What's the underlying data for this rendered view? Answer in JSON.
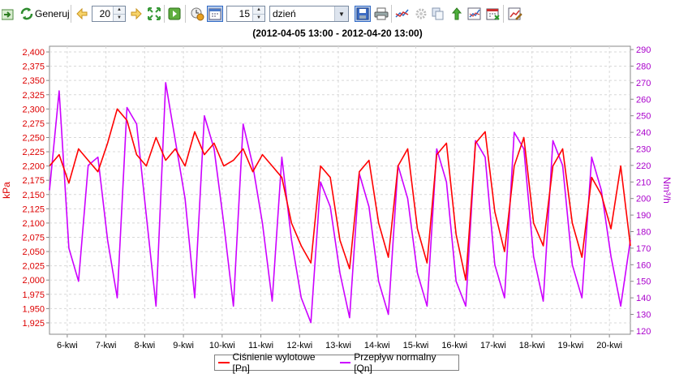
{
  "toolbar": {
    "generate_label": "Generuj",
    "count_value": "20",
    "interval_value": "15",
    "period_value": "dzień",
    "colors": {
      "accent": "#316ac5"
    }
  },
  "chart_data": {
    "type": "line",
    "title": "(2012-04-05 13:00 - 2012-04-20 13:00)",
    "xlabel": "",
    "ylabel": "kPa",
    "ylabel_right": "Nm³/h",
    "x_tick_labels": [
      "6-kwi",
      "7-kwi",
      "8-kwi",
      "9-kwi",
      "10-kwi",
      "11-kwi",
      "12-kwi",
      "13-kwi",
      "14-kwi",
      "15-kwi",
      "16-kwi",
      "17-kwi",
      "18-kwi",
      "19-kwi",
      "20-kwi"
    ],
    "x_range": [
      "2012-04-05 13:00",
      "2012-04-20 13:00"
    ],
    "y_left_ticks": [
      "1,925",
      "1,950",
      "1,975",
      "2,000",
      "2,025",
      "2,050",
      "2,075",
      "2,100",
      "2,125",
      "2,150",
      "2,175",
      "2,200",
      "2,225",
      "2,250",
      "2,275",
      "2,300",
      "2,325",
      "2,350",
      "2,375",
      "2,400"
    ],
    "y_right_ticks": [
      "120",
      "130",
      "140",
      "150",
      "160",
      "170",
      "180",
      "190",
      "200",
      "210",
      "220",
      "230",
      "240",
      "250",
      "260",
      "270",
      "280",
      "290"
    ],
    "ylim_left": [
      1.905,
      2.41
    ],
    "ylim_right": [
      118,
      292
    ],
    "grid": true,
    "legend_position": "bottom-center",
    "series": [
      {
        "name": "Ciśnienie wylotowe [Pn]",
        "axis": "left",
        "color": "#ff0000",
        "x": [
          "2012-04-05 13:00",
          "2012-04-05 19:00",
          "2012-04-06 01:00",
          "2012-04-06 07:00",
          "2012-04-06 13:00",
          "2012-04-06 19:00",
          "2012-04-07 01:00",
          "2012-04-07 07:00",
          "2012-04-07 13:00",
          "2012-04-07 19:00",
          "2012-04-08 01:00",
          "2012-04-08 07:00",
          "2012-04-08 13:00",
          "2012-04-08 19:00",
          "2012-04-09 01:00",
          "2012-04-09 07:00",
          "2012-04-09 13:00",
          "2012-04-09 19:00",
          "2012-04-10 01:00",
          "2012-04-10 07:00",
          "2012-04-10 13:00",
          "2012-04-10 19:00",
          "2012-04-11 01:00",
          "2012-04-11 07:00",
          "2012-04-11 13:00",
          "2012-04-11 19:00",
          "2012-04-12 01:00",
          "2012-04-12 07:00",
          "2012-04-12 13:00",
          "2012-04-12 19:00",
          "2012-04-13 01:00",
          "2012-04-13 07:00",
          "2012-04-13 13:00",
          "2012-04-13 19:00",
          "2012-04-14 01:00",
          "2012-04-14 07:00",
          "2012-04-14 13:00",
          "2012-04-14 19:00",
          "2012-04-15 01:00",
          "2012-04-15 07:00",
          "2012-04-15 13:00",
          "2012-04-15 19:00",
          "2012-04-16 01:00",
          "2012-04-16 07:00",
          "2012-04-16 13:00",
          "2012-04-16 19:00",
          "2012-04-17 01:00",
          "2012-04-17 07:00",
          "2012-04-17 13:00",
          "2012-04-17 19:00",
          "2012-04-18 01:00",
          "2012-04-18 07:00",
          "2012-04-18 13:00",
          "2012-04-18 19:00",
          "2012-04-19 01:00",
          "2012-04-19 07:00",
          "2012-04-19 13:00",
          "2012-04-19 19:00",
          "2012-04-20 01:00",
          "2012-04-20 07:00",
          "2012-04-20 13:00"
        ],
        "values": [
          2.2,
          2.22,
          2.17,
          2.23,
          2.21,
          2.19,
          2.24,
          2.3,
          2.28,
          2.22,
          2.2,
          2.25,
          2.21,
          2.23,
          2.2,
          2.26,
          2.22,
          2.24,
          2.2,
          2.21,
          2.23,
          2.19,
          2.22,
          2.2,
          2.18,
          2.1,
          2.06,
          2.03,
          2.2,
          2.18,
          2.07,
          2.02,
          2.19,
          2.21,
          2.1,
          2.04,
          2.2,
          2.23,
          2.09,
          2.03,
          2.22,
          2.24,
          2.08,
          2.0,
          2.24,
          2.26,
          2.12,
          2.05,
          2.2,
          2.25,
          2.1,
          2.06,
          2.2,
          2.23,
          2.1,
          2.04,
          2.18,
          2.15,
          2.09,
          2.2,
          2.06
        ]
      },
      {
        "name": "Przepływ normalny [Qn]",
        "axis": "right",
        "color": "#cc00ff",
        "x": [
          "2012-04-05 13:00",
          "2012-04-05 19:00",
          "2012-04-06 01:00",
          "2012-04-06 07:00",
          "2012-04-06 13:00",
          "2012-04-06 19:00",
          "2012-04-07 01:00",
          "2012-04-07 07:00",
          "2012-04-07 13:00",
          "2012-04-07 19:00",
          "2012-04-08 01:00",
          "2012-04-08 07:00",
          "2012-04-08 13:00",
          "2012-04-08 19:00",
          "2012-04-09 01:00",
          "2012-04-09 07:00",
          "2012-04-09 13:00",
          "2012-04-09 19:00",
          "2012-04-10 01:00",
          "2012-04-10 07:00",
          "2012-04-10 13:00",
          "2012-04-10 19:00",
          "2012-04-11 01:00",
          "2012-04-11 07:00",
          "2012-04-11 13:00",
          "2012-04-11 19:00",
          "2012-04-12 01:00",
          "2012-04-12 07:00",
          "2012-04-12 13:00",
          "2012-04-12 19:00",
          "2012-04-13 01:00",
          "2012-04-13 07:00",
          "2012-04-13 13:00",
          "2012-04-13 19:00",
          "2012-04-14 01:00",
          "2012-04-14 07:00",
          "2012-04-14 13:00",
          "2012-04-14 19:00",
          "2012-04-15 01:00",
          "2012-04-15 07:00",
          "2012-04-15 13:00",
          "2012-04-15 19:00",
          "2012-04-16 01:00",
          "2012-04-16 07:00",
          "2012-04-16 13:00",
          "2012-04-16 19:00",
          "2012-04-17 01:00",
          "2012-04-17 07:00",
          "2012-04-17 13:00",
          "2012-04-17 19:00",
          "2012-04-18 01:00",
          "2012-04-18 07:00",
          "2012-04-18 13:00",
          "2012-04-18 19:00",
          "2012-04-19 01:00",
          "2012-04-19 07:00",
          "2012-04-19 13:00",
          "2012-04-19 19:00",
          "2012-04-20 01:00",
          "2012-04-20 07:00",
          "2012-04-20 13:00"
        ],
        "values": [
          205,
          265,
          170,
          150,
          220,
          225,
          175,
          140,
          255,
          245,
          190,
          135,
          270,
          235,
          200,
          140,
          250,
          230,
          185,
          135,
          245,
          220,
          185,
          138,
          225,
          175,
          140,
          125,
          210,
          195,
          155,
          128,
          215,
          195,
          150,
          130,
          220,
          200,
          155,
          135,
          230,
          210,
          150,
          135,
          235,
          225,
          160,
          140,
          240,
          230,
          165,
          138,
          235,
          220,
          160,
          140,
          225,
          205,
          165,
          135,
          175
        ]
      }
    ]
  }
}
